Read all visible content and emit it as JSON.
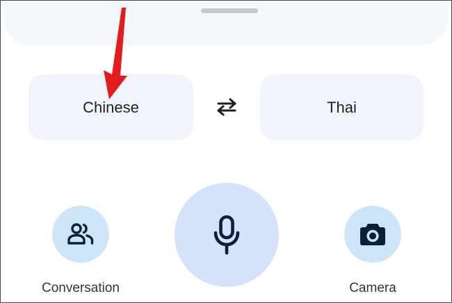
{
  "languages": {
    "source": "Chinese",
    "target": "Thai"
  },
  "actions": {
    "conversation_label": "Conversation",
    "camera_label": "Camera"
  },
  "icons": {
    "swap": "swap-arrows-icon",
    "mic": "microphone-icon",
    "conversation": "people-icon",
    "camera": "camera-icon",
    "annotation": "red-arrow-icon"
  },
  "colors": {
    "annotation_red": "#e51a1a",
    "mic_button_bg": "#d4e3fb",
    "side_button_bg": "#cde5f8",
    "icon_dark": "#0b1e3a",
    "chip_bg": "#f1f5fb"
  }
}
